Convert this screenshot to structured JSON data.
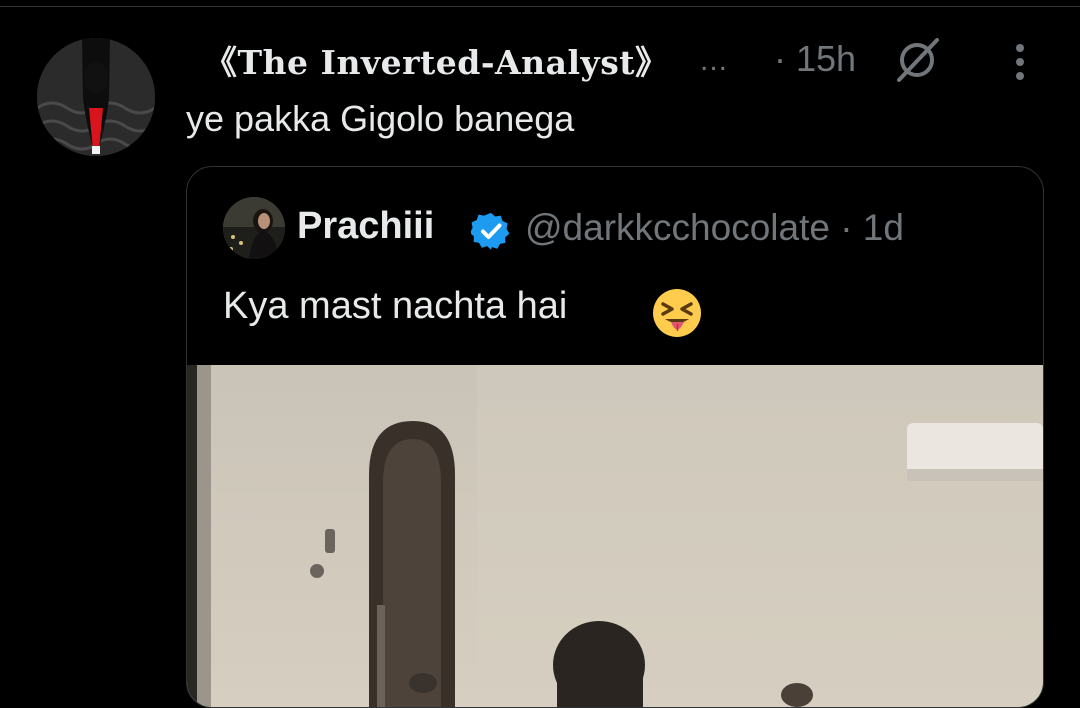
{
  "tweet": {
    "author_name": "《The Inverted-Analyst》",
    "ellipsis": "...",
    "time": "· 15h",
    "text": "ye pakka Gigolo banega",
    "icons": {
      "grok": "grok-slash-icon",
      "more": "more-vertical-icon"
    }
  },
  "quote": {
    "name": "Prachiii",
    "verified_icon": "verified-badge-icon",
    "handle_time": "@darkkcchocolate · 1d",
    "text": "Kya mast nachta hai",
    "emoji": "squinting-face-with-tongue-emoji"
  },
  "colors": {
    "background": "#000000",
    "text": "#e7e9ea",
    "muted": "#71767b",
    "border": "#2f3336",
    "verified": "#1d9bf0"
  }
}
